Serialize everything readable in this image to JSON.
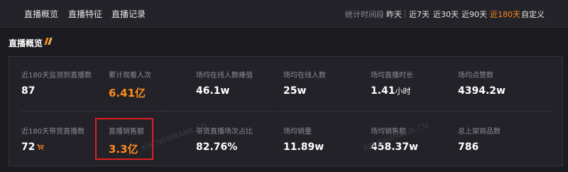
{
  "header": {
    "tabs": [
      "直播概览",
      "直播特征",
      "直播记录"
    ],
    "period_label": "统计时间段",
    "ranges": [
      "昨天",
      "近7天",
      "近30天",
      "近90天",
      "近180天",
      "自定义"
    ],
    "selected_range": "近180天"
  },
  "section": {
    "title": "直播概览"
  },
  "metrics_row1": [
    {
      "label": "近180天监测到直播数",
      "value": "87"
    },
    {
      "label": "累计观看人次",
      "value": "6.41亿"
    },
    {
      "label": "场均在线人数峰值",
      "value": "46.1w"
    },
    {
      "label": "场均在线人数",
      "value": "25w"
    },
    {
      "label": "场均直播时长",
      "value": "1.41",
      "unit": "小时"
    },
    {
      "label": "场均点赞数",
      "value": "4394.2w"
    }
  ],
  "metrics_row2": [
    {
      "label": "近180天带货直播数",
      "value": "72"
    },
    {
      "label": "直播销售额",
      "value": "3.3亿"
    },
    {
      "label": "带货直播场次占比",
      "value": "82.76%"
    },
    {
      "label": "场均销量",
      "value": "11.89w"
    },
    {
      "label": "场均销售额",
      "value": "458.37w"
    },
    {
      "label": "总上架商品数",
      "value": "786"
    }
  ],
  "watermarks": [
    "XIN.NEWRANK.CN",
    "XIN.NEWRANK.CN"
  ],
  "colors": {
    "accent": "#ff8a1e",
    "highlight_border": "#e02020",
    "background": "#1b1b20"
  },
  "icons": {
    "cart": "shopping-cart-icon",
    "title_mark": "double-slash-icon"
  }
}
